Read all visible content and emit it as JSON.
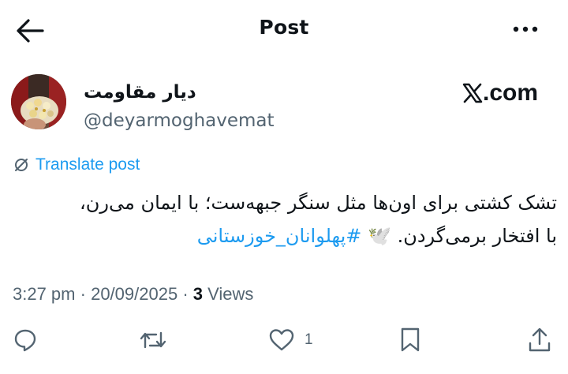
{
  "header": {
    "title": "Post",
    "back_icon": "arrow-left-icon",
    "more_icon": "more-horizontal-icon"
  },
  "author": {
    "name": "دیار مقاومت",
    "handle": "@deyarmoghavemat"
  },
  "source": {
    "logo_text": ".com",
    "logo_icon": "x-logo-icon"
  },
  "translate": {
    "label": "Translate post",
    "icon": "translate-icon"
  },
  "post": {
    "line1": "تشک کشتی برای اون‌ها مثل سنگر جبهه‌ست؛ با ایمان می‌رن،",
    "line2": "با افتخار برمی‌گردن.",
    "dove_emoji": "🕊️",
    "hashtag": "#پهلوانان_خوزستانی"
  },
  "meta": {
    "time": "3:27 pm",
    "separator": "·",
    "date": "20/09/2025",
    "views_count": "3",
    "views_label": "Views"
  },
  "actions": {
    "reply_icon": "reply-icon",
    "repost_icon": "repost-icon",
    "like_icon": "like-icon",
    "like_count": "1",
    "bookmark_icon": "bookmark-icon",
    "share_icon": "share-icon"
  },
  "colors": {
    "accent": "#1d9bf0",
    "text": "#0f1419",
    "muted": "#536471"
  }
}
